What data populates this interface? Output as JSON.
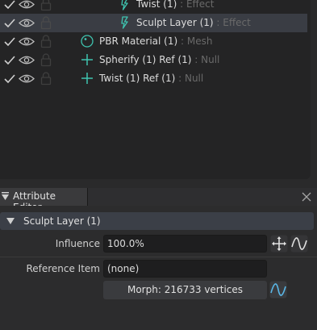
{
  "item_list": {
    "rows": [
      {
        "name": "Twist (1)",
        "type": " : Effect",
        "icon": "effect-lightning-icon",
        "selected": false
      },
      {
        "name": "Sculpt Layer (1)",
        "type": " : Effect",
        "icon": "effect-lightning-icon",
        "selected": true
      },
      {
        "name": "PBR Material (1)",
        "type": " : Mesh",
        "icon": "material-sphere-icon",
        "selected": false
      },
      {
        "name": "Spherify (1) Ref (1)",
        "type": " : Null",
        "icon": "null-cross-icon",
        "selected": false
      },
      {
        "name": "Twist (1) Ref (1)",
        "type": " : Null",
        "icon": "null-cross-icon",
        "selected": false
      }
    ]
  },
  "attribute_editor": {
    "tab_title": "Attribute Editor",
    "section_title": "Sculpt Layer (1)",
    "influence_label": "Influence",
    "influence_value": "100.0%",
    "reference_label": "Reference Item",
    "reference_value": "(none)",
    "morph_button": "Morph: 216733 vertices"
  },
  "colors": {
    "accent_teal": "#3fc4b0",
    "selected_row": "#3a3d44"
  }
}
